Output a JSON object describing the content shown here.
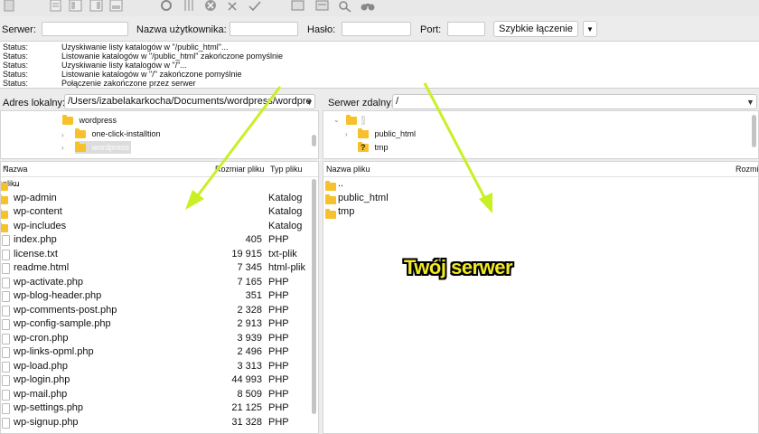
{
  "quickconnect": {
    "host_label": "Serwer:",
    "user_label": "Nazwa użytkownika:",
    "pass_label": "Hasło:",
    "port_label": "Port:",
    "host_value": "",
    "user_value": "",
    "pass_value": "",
    "port_value": "",
    "connect_button": "Szybkie łączenie"
  },
  "log": [
    {
      "label": "Status:",
      "message": "Uzyskiwanie listy katalogów w \"/public_html\"..."
    },
    {
      "label": "Status:",
      "message": "Listowanie katalogów w \"/public_html\" zakończone pomyślnie"
    },
    {
      "label": "Status:",
      "message": "Uzyskiwanie listy katalogów w \"/\"..."
    },
    {
      "label": "Status:",
      "message": "Listowanie katalogów w \"/\" zakończone pomyślnie"
    },
    {
      "label": "Status:",
      "message": "Połączenie zakończone przez serwer"
    }
  ],
  "local": {
    "address_label": "Adres lokalny:",
    "address_value": "/Users/izabelakarkocha/Documents/wordpress/wordpre",
    "tree": [
      {
        "name": "wordpress"
      },
      {
        "name": "one-click-installtion"
      },
      {
        "name": "wordpress"
      }
    ],
    "columns": {
      "name": "Nazwa pliku",
      "size": "Rozmiar pliku",
      "type": "Typ pliku"
    },
    "files": [
      {
        "name": "..",
        "size": "",
        "type": "",
        "kind": "folder"
      },
      {
        "name": "wp-admin",
        "size": "",
        "type": "Katalog",
        "kind": "folder"
      },
      {
        "name": "wp-content",
        "size": "",
        "type": "Katalog",
        "kind": "folder"
      },
      {
        "name": "wp-includes",
        "size": "",
        "type": "Katalog",
        "kind": "folder"
      },
      {
        "name": "index.php",
        "size": "405",
        "type": "PHP",
        "kind": "file"
      },
      {
        "name": "license.txt",
        "size": "19 915",
        "type": "txt-plik",
        "kind": "file"
      },
      {
        "name": "readme.html",
        "size": "7 345",
        "type": "html-plik",
        "kind": "file"
      },
      {
        "name": "wp-activate.php",
        "size": "7 165",
        "type": "PHP",
        "kind": "file"
      },
      {
        "name": "wp-blog-header.php",
        "size": "351",
        "type": "PHP",
        "kind": "file"
      },
      {
        "name": "wp-comments-post.php",
        "size": "2 328",
        "type": "PHP",
        "kind": "file"
      },
      {
        "name": "wp-config-sample.php",
        "size": "2 913",
        "type": "PHP",
        "kind": "file"
      },
      {
        "name": "wp-cron.php",
        "size": "3 939",
        "type": "PHP",
        "kind": "file"
      },
      {
        "name": "wp-links-opml.php",
        "size": "2 496",
        "type": "PHP",
        "kind": "file"
      },
      {
        "name": "wp-load.php",
        "size": "3 313",
        "type": "PHP",
        "kind": "file"
      },
      {
        "name": "wp-login.php",
        "size": "44 993",
        "type": "PHP",
        "kind": "file"
      },
      {
        "name": "wp-mail.php",
        "size": "8 509",
        "type": "PHP",
        "kind": "file"
      },
      {
        "name": "wp-settings.php",
        "size": "21 125",
        "type": "PHP",
        "kind": "file"
      },
      {
        "name": "wp-signup.php",
        "size": "31 328",
        "type": "PHP",
        "kind": "file"
      }
    ]
  },
  "remote": {
    "address_label": "Serwer zdalny:",
    "address_value": "/",
    "tree": [
      {
        "name": "/"
      },
      {
        "name": "public_html"
      },
      {
        "name": "tmp"
      }
    ],
    "columns": {
      "name": "Nazwa pliku",
      "size": "Rozmi"
    },
    "files": [
      {
        "name": ".."
      },
      {
        "name": "public_html"
      },
      {
        "name": "tmp"
      }
    ]
  },
  "annotation": {
    "caption": "Twój serwer",
    "arrow_color": "#c8f025",
    "caption_color": "#f2ea22"
  },
  "icons": [
    "disconnect-icon",
    "file-icon",
    "layout-icon",
    "refresh-icon",
    "filter-icon",
    "cancel-icon",
    "compare-icon",
    "search-icon",
    "binoculars-icon",
    "folder-icon",
    "unknown-folder-icon",
    "chevron-down-icon",
    "sort-up-icon"
  ]
}
